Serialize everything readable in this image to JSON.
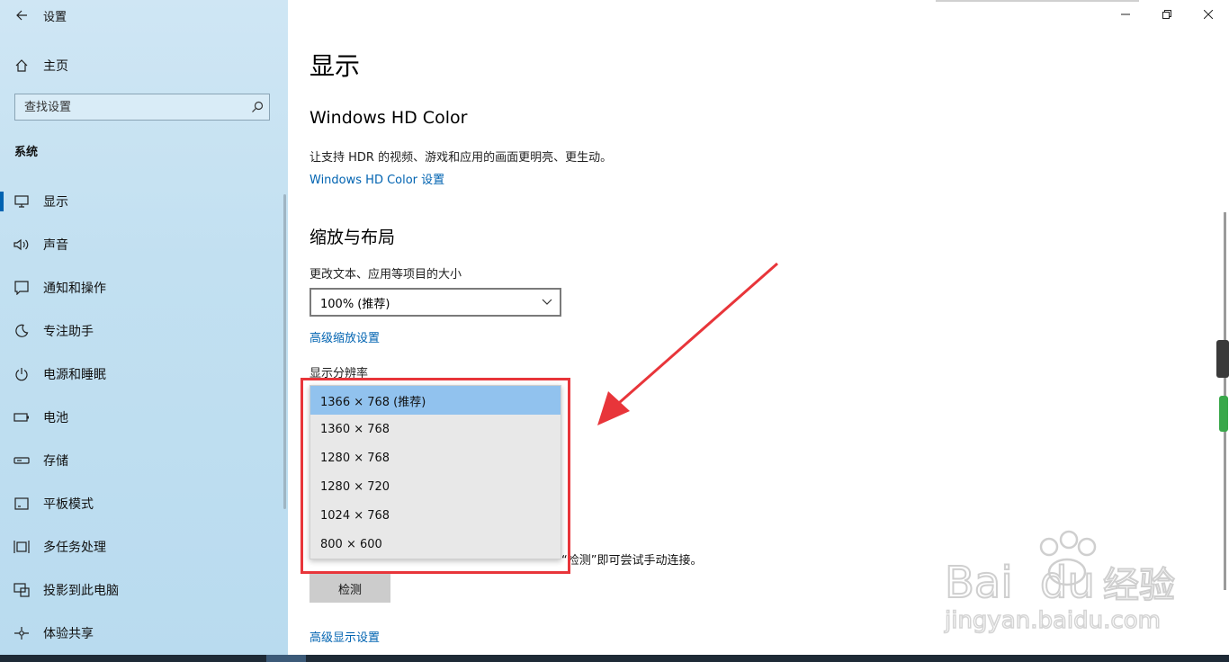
{
  "window": {
    "title": "设置"
  },
  "sidebar": {
    "home_label": "主页",
    "search_placeholder": "查找设置",
    "section": "系统",
    "items": [
      {
        "label": "显示",
        "icon": "monitor-icon",
        "active": true
      },
      {
        "label": "声音",
        "icon": "speaker-icon"
      },
      {
        "label": "通知和操作",
        "icon": "message-icon"
      },
      {
        "label": "专注助手",
        "icon": "moon-icon"
      },
      {
        "label": "电源和睡眠",
        "icon": "power-icon"
      },
      {
        "label": "电池",
        "icon": "battery-icon"
      },
      {
        "label": "存储",
        "icon": "storage-icon"
      },
      {
        "label": "平板模式",
        "icon": "tablet-icon"
      },
      {
        "label": "多任务处理",
        "icon": "multitask-icon"
      },
      {
        "label": "投影到此电脑",
        "icon": "project-icon"
      },
      {
        "label": "体验共享",
        "icon": "share-icon"
      }
    ]
  },
  "content": {
    "page_title": "显示",
    "hd_color": {
      "heading": "Windows HD Color",
      "description": "让支持 HDR 的视频、游戏和应用的画面更明亮、更生动。",
      "link": "Windows HD Color 设置"
    },
    "scale_layout": {
      "heading": "缩放与布局",
      "size_label": "更改文本、应用等项目的大小",
      "size_value": "100% (推荐)",
      "advanced_scaling_link": "高级缩放设置",
      "resolution_label": "显示分辨率",
      "resolution_options": [
        "1366 × 768 (推荐)",
        "1360 × 768",
        "1280 × 768",
        "1280 × 720",
        "1024 × 768",
        "800 × 600"
      ],
      "selected_index": 0
    },
    "detect_text": "“检测”即可尝试手动连接。",
    "detect_button": "检测",
    "advanced_display_link": "高级显示设置"
  },
  "colors": {
    "accent": "#0063b1",
    "highlight": "#e8353a",
    "selected_option": "#91c2ee"
  },
  "watermark": {
    "brand": "Baidu经验",
    "url": "jingyan.baidu.com"
  }
}
